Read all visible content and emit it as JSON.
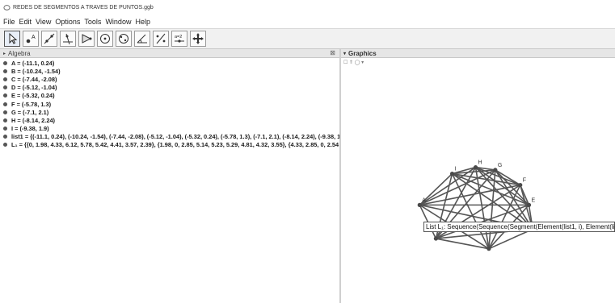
{
  "window": {
    "title": "REDES DE SEGMENTOS A TRAVES DE PUNTOS.ggb"
  },
  "menu": [
    "File",
    "Edit",
    "View",
    "Options",
    "Tools",
    "Window",
    "Help"
  ],
  "toolbar": {
    "tools": [
      "move-tool-icon",
      "point-tool-icon",
      "line-tool-icon",
      "perpendicular-tool-icon",
      "polygon-tool-icon",
      "circle-tool-icon",
      "conic-tool-icon",
      "angle-tool-icon",
      "reflect-tool-icon",
      "slider-tool-icon",
      "move-view-tool-icon"
    ],
    "slider_glyph": "a=2"
  },
  "algebra": {
    "title": "Algebra",
    "close": "⊠",
    "rows": [
      "A = (-11.1, 0.24)",
      "B = (-10.24, -1.54)",
      "C = (-7.44, -2.08)",
      "D = (-5.12, -1.04)",
      "E = (-5.32, 0.24)",
      "F = (-5.78, 1.3)",
      "G = (-7.1, 2.1)",
      "H = (-8.14, 2.24)",
      "I = (-9.38, 1.9)",
      "list1 = {(-11.1, 0.24), (-10.24, -1.54), (-7.44, -2.08), (-5.12, -1.04), (-5.32, 0.24), (-5.78, 1.3), (-7.1, 2.1), (-8.14, 2.24), (-9.38, 1",
      "L₁ = {{0, 1.98, 4.33, 6.12, 5.78, 5.42, 4.41, 3.57, 2.39}, {1.98, 0, 2.85, 5.14, 5.23, 5.29, 4.81, 4.32, 3.55}, {4.33, 2.85, 0, 2.54"
    ]
  },
  "graphics": {
    "title": "Graphics",
    "bar_glyphs": "☐  ⇑ ◯ ▾",
    "points": [
      {
        "name": "A",
        "x": -11.1,
        "y": 0.24,
        "show_label": true
      },
      {
        "name": "B",
        "x": -10.24,
        "y": -1.54,
        "show_label": false
      },
      {
        "name": "C",
        "x": -7.44,
        "y": -2.08,
        "show_label": false
      },
      {
        "name": "D",
        "x": -5.12,
        "y": -1.04,
        "show_label": true
      },
      {
        "name": "E",
        "x": -5.32,
        "y": 0.24,
        "show_label": true
      },
      {
        "name": "F",
        "x": -5.78,
        "y": 1.3,
        "show_label": true
      },
      {
        "name": "G",
        "x": -7.1,
        "y": 2.1,
        "show_label": true
      },
      {
        "name": "H",
        "x": -8.14,
        "y": 2.24,
        "show_label": true
      },
      {
        "name": "I",
        "x": -9.38,
        "y": 1.9,
        "show_label": true
      }
    ]
  },
  "tooltip": {
    "text": "List L₁:  Sequence(Sequence(Segment(Element(list1, i), Element(list1, j)"
  },
  "colors": {
    "segment": "#555555",
    "point": "#4a4a4a",
    "toolbar_bg": "#f1f1f1"
  }
}
